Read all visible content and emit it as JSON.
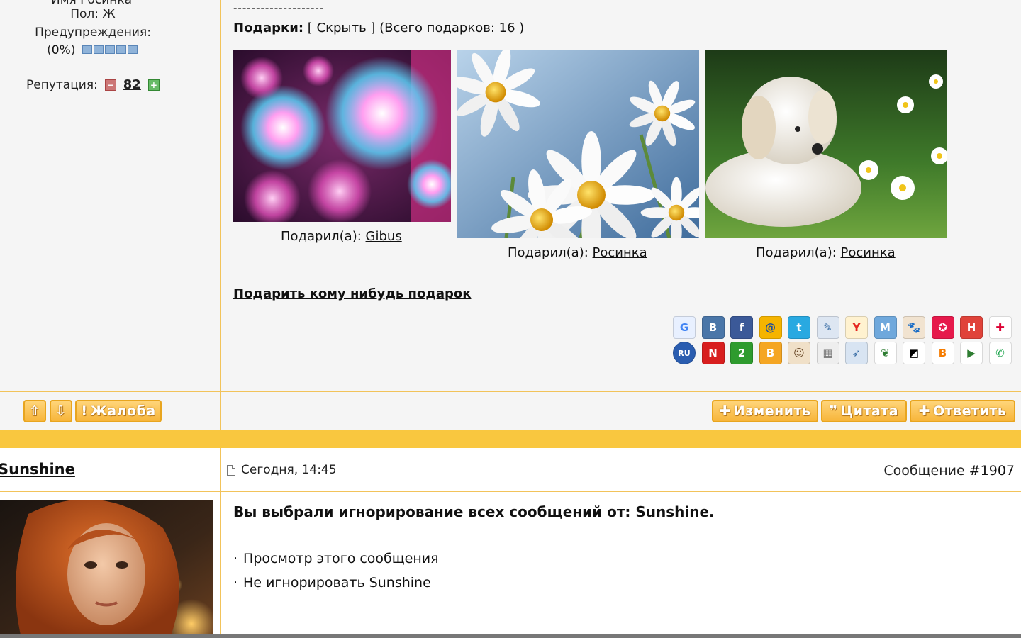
{
  "profile": {
    "cut_line": "Имя Росинка",
    "gender": "Пол: Ж",
    "warnings_label": "Предупреждения:",
    "warnings_percent": "0%",
    "reputation_label": "Репутация:",
    "reputation_value": "82"
  },
  "gifts": {
    "dashes": "--------------------",
    "label": "Подарки:",
    "hide_link": "Скрыть",
    "total_label": "(Всего подарков:",
    "total_count": "16",
    "given_by_label": "Подарил(а):",
    "items": [
      {
        "giver": "Gibus"
      },
      {
        "giver": "Росинка"
      },
      {
        "giver": "Росинка"
      }
    ],
    "give_gift_link": "Подарить кому нибудь подарок"
  },
  "share_icons": [
    "google-bookmarks",
    "vkontakte",
    "facebook",
    "mail-ru",
    "twitter",
    "livejournal",
    "yandex",
    "moi-mir",
    "bobrdobr",
    "memori",
    "habrahabr",
    "misterwong",
    "rambler",
    "news2",
    "2",
    "blogger",
    "person",
    "grid",
    "tracker",
    "wheat",
    "delicious",
    "blogger-b",
    "play",
    "liveinternet"
  ],
  "actions": {
    "up": "⇧",
    "down": "⇩",
    "complaint": "Жалоба",
    "edit": "Изменить",
    "quote": "Цитата",
    "reply": "Ответить"
  },
  "post2": {
    "user": "Sunshine",
    "date": "Сегодня, 14:45",
    "message_label": "Сообщение",
    "message_number": "#1907",
    "ignore_text": "Вы выбрали игнорирование всех сообщений от: Sunshine.",
    "view_link": "Просмотр этого сообщения",
    "unignore_link": "Не игнорировать Sunshine"
  },
  "colors": {
    "accent": "#f9c73f",
    "border": "#f2c35a",
    "panel": "#f5f5f5"
  }
}
